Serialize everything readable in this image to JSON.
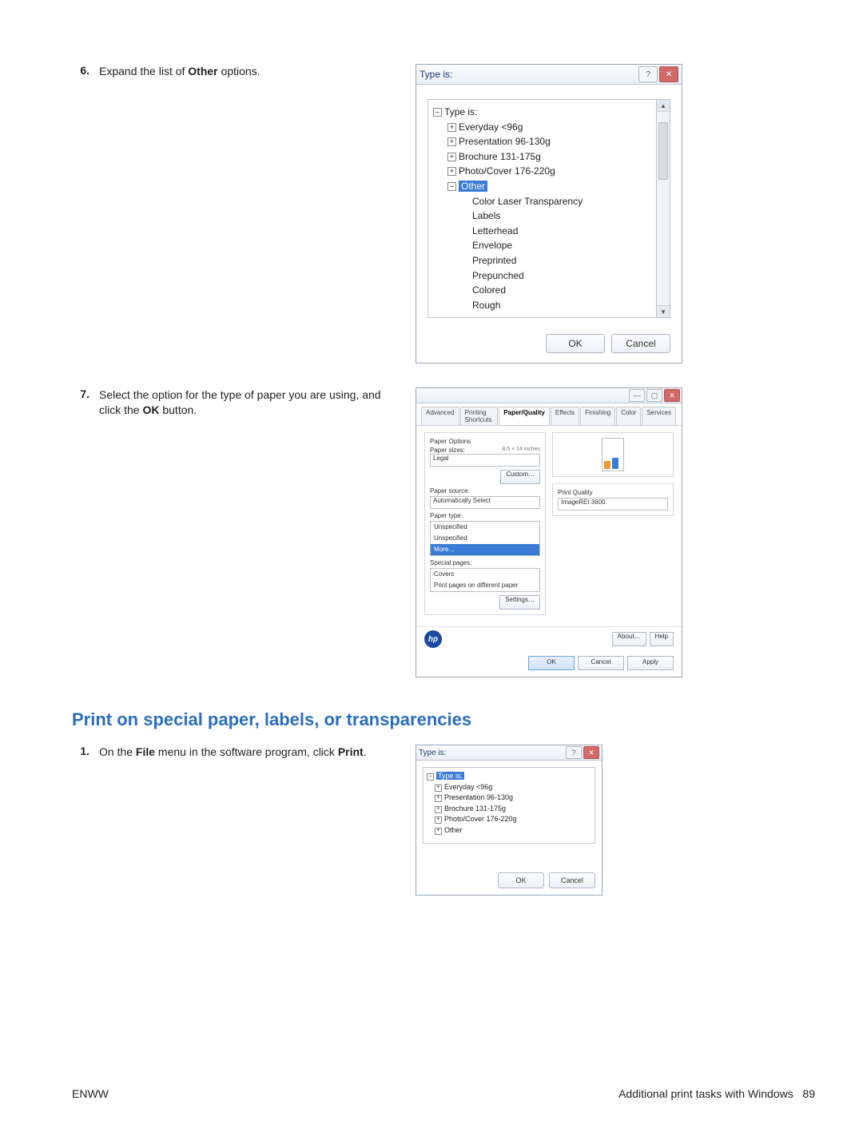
{
  "steps": {
    "s6": {
      "num": "6.",
      "text_a": "Expand the list of ",
      "bold": "Other",
      "text_b": " options."
    },
    "s7": {
      "num": "7.",
      "text_a": "Select the option for the type of paper you are using, and click the ",
      "bold": "OK",
      "text_b": " button."
    },
    "s1": {
      "num": "1.",
      "text_a": "On the ",
      "bold1": "File",
      "text_b": " menu in the software program, click ",
      "bold2": "Print",
      "text_c": "."
    }
  },
  "section_heading": "Print on special paper, labels, or transparencies",
  "footer": {
    "left": "ENWW",
    "right_label": "Additional print tasks with Windows",
    "page": "89"
  },
  "dlg1": {
    "title": "Type is:",
    "root": "Type is:",
    "collapsed": [
      "Everyday <96g",
      "Presentation 96-130g",
      "Brochure 131-175g",
      "Photo/Cover 176-220g"
    ],
    "expanded_node": "Other",
    "children": [
      "Color Laser Transparency",
      "Labels",
      "Letterhead",
      "Envelope",
      "Preprinted",
      "Prepunched",
      "Colored",
      "Rough"
    ],
    "ok": "OK",
    "cancel": "Cancel"
  },
  "dlg2": {
    "tabs": [
      "Advanced",
      "Printing Shortcuts",
      "Paper/Quality",
      "Effects",
      "Finishing",
      "Color",
      "Services"
    ],
    "active_tab": 2,
    "paper_options_label": "Paper Options",
    "paper_sizes_label": "Paper sizes:",
    "paper_size_hint": "8.5 × 14 inches",
    "paper_size_value": "Legal",
    "custom_btn": "Custom…",
    "paper_source_label": "Paper source:",
    "paper_source_value": "Automatically Select",
    "paper_type_label": "Paper type:",
    "paper_type_options": [
      "Unspecified",
      "Unspecified",
      "More…"
    ],
    "paper_type_sel_index": 2,
    "special_pages_label": "Special pages:",
    "special_rows": [
      "Covers",
      "Print pages on different paper"
    ],
    "settings_btn": "Settings…",
    "print_quality_label": "Print Quality",
    "print_quality_value": "ImageREt 3600",
    "about": "About…",
    "help": "Help",
    "ok": "OK",
    "cancel": "Cancel",
    "apply": "Apply",
    "hp": "hp"
  },
  "dlg3": {
    "title": "Type is:",
    "root": "Type is:",
    "items": [
      "Everyday <96g",
      "Presentation 96-130g",
      "Brochure 131-175g",
      "Photo/Cover 176-220g",
      "Other"
    ],
    "ok": "OK",
    "cancel": "Cancel"
  }
}
